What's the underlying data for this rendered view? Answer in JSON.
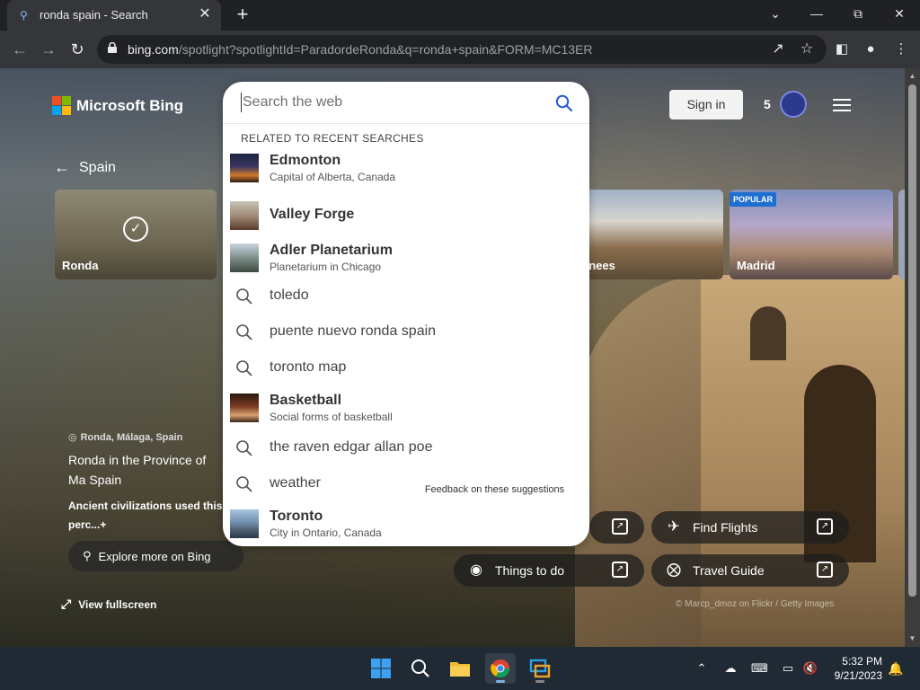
{
  "browser": {
    "tab_title": "ronda spain - Search",
    "url_host": "bing.com",
    "url_path": "/spotlight?spotlightId=ParadordeRonda&q=ronda+spain&FORM=MC13ER"
  },
  "bing": {
    "logo_text": "Microsoft Bing",
    "sign_in": "Sign in",
    "points": "5",
    "back_label": "Spain",
    "cards": [
      {
        "label": "Ronda"
      },
      {
        "label": "enees"
      },
      {
        "label": "Madrid",
        "badge": "POPULAR"
      }
    ],
    "info": {
      "location": "Ronda, Málaga, Spain",
      "headline": "Ronda in the Province of Ma Spain",
      "description": "Ancient civilizations used this perc...",
      "more_glyph": "+"
    },
    "explore": "Explore more on Bing",
    "view_fullscreen": "View fullscreen",
    "pills": {
      "find_flights": "Find Flights",
      "travel_guide": "Travel Guide",
      "things_to_do": "Things to do"
    },
    "credit": "© Marcp_dmoz on Flickr / Getty Images"
  },
  "search": {
    "placeholder": "Search the web",
    "section_header": "RELATED TO RECENT SEARCHES",
    "suggestions": [
      {
        "name": "Edmonton",
        "sub": "Capital of Alberta, Canada"
      },
      {
        "name": "Valley Forge"
      },
      {
        "name": "Adler Planetarium",
        "sub": "Planetarium in Chicago"
      },
      {
        "query": "toledo"
      },
      {
        "query": "puente nuevo ronda spain"
      },
      {
        "query": "toronto map"
      },
      {
        "name": "Basketball",
        "sub": "Social forms of basketball"
      },
      {
        "query": "the raven edgar allan poe"
      },
      {
        "query": "weather"
      },
      {
        "name": "Toronto",
        "sub": "City in Ontario, Canada"
      }
    ],
    "feedback": "Feedback on these suggestions"
  },
  "taskbar": {
    "time": "5:32 PM",
    "date": "9/21/2023"
  },
  "colors": {
    "accent": "#1d6fd0",
    "search_icon": "#2a5ad8"
  }
}
